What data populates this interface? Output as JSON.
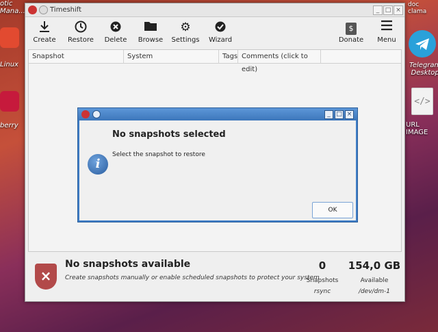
{
  "desktop": {
    "left_item_1": "otic\nMana...",
    "left_item_2": "Linux",
    "left_item_3": "berry",
    "right_item_1": "Telegram\nDesktop",
    "right_item_2": "URL IMAGE",
    "top_right_text": "doc clama"
  },
  "window": {
    "title": "Timeshift",
    "toolbar": {
      "create": "Create",
      "restore": "Restore",
      "delete": "Delete",
      "browse": "Browse",
      "settings": "Settings",
      "wizard": "Wizard",
      "donate": "Donate",
      "menu": "Menu"
    },
    "table": {
      "columns": [
        "Snapshot",
        "System",
        "Tags",
        "Comments (click to edit)"
      ]
    },
    "status": {
      "title": "No snapshots available",
      "subtitle": "Create snapshots manually or enable scheduled snapshots to protect your system",
      "count": "0",
      "count_label": "Snapshots",
      "count_sub": "rsync",
      "size": "154,0 GB",
      "size_label": "Available",
      "size_sub": "/dev/dm-1"
    }
  },
  "dialog": {
    "title": "No snapshots selected",
    "message": "Select the snapshot to restore",
    "ok_label": "OK"
  },
  "colors": {
    "dialog_border": "#3f7ec7",
    "shield": "#b24a4a"
  }
}
